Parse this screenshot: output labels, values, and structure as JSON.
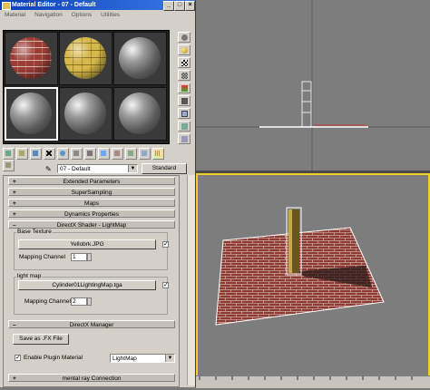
{
  "window": {
    "title": "Material Editor - 07 - Default",
    "minimize": "_",
    "maximize": "□",
    "close": "×"
  },
  "menu": [
    "Material",
    "Navigation",
    "Options",
    "Utilities"
  ],
  "material": {
    "name": "07 - Default",
    "type_button": "Standard"
  },
  "rollouts": {
    "extended": "Extended Parameters",
    "supersampling": "SuperSampling",
    "maps": "Maps",
    "dynamics": "Dynamics Properties",
    "directx_shader": "DirectX Shader - LightMap",
    "directx_manager": "DirectX Manager",
    "mentalray": "mental ray Connection"
  },
  "base_texture": {
    "label": "Base Texture",
    "file": "Yellobrk.JPG",
    "mapping_label": "Mapping Channel",
    "mapping_value": "1",
    "checked": "✓"
  },
  "light_map": {
    "label": "light map",
    "file": "Cylinder01LightingMap.tga",
    "mapping_label": "Mapping Channel",
    "mapping_value": "2",
    "checked": "✓"
  },
  "dx_manager": {
    "save_button": "Save as .FX File",
    "enable_label": "Enable Plugin Material",
    "enable_checked": "✓",
    "plugin_value": "LightMap"
  },
  "signs": {
    "plus": "+",
    "minus": "–"
  },
  "colors": {
    "title_bar": "#0a3fb8",
    "active_viewport_border": "#f0d020",
    "viewport_bg": "#7d7d7d",
    "brick": "#9b3d36"
  }
}
